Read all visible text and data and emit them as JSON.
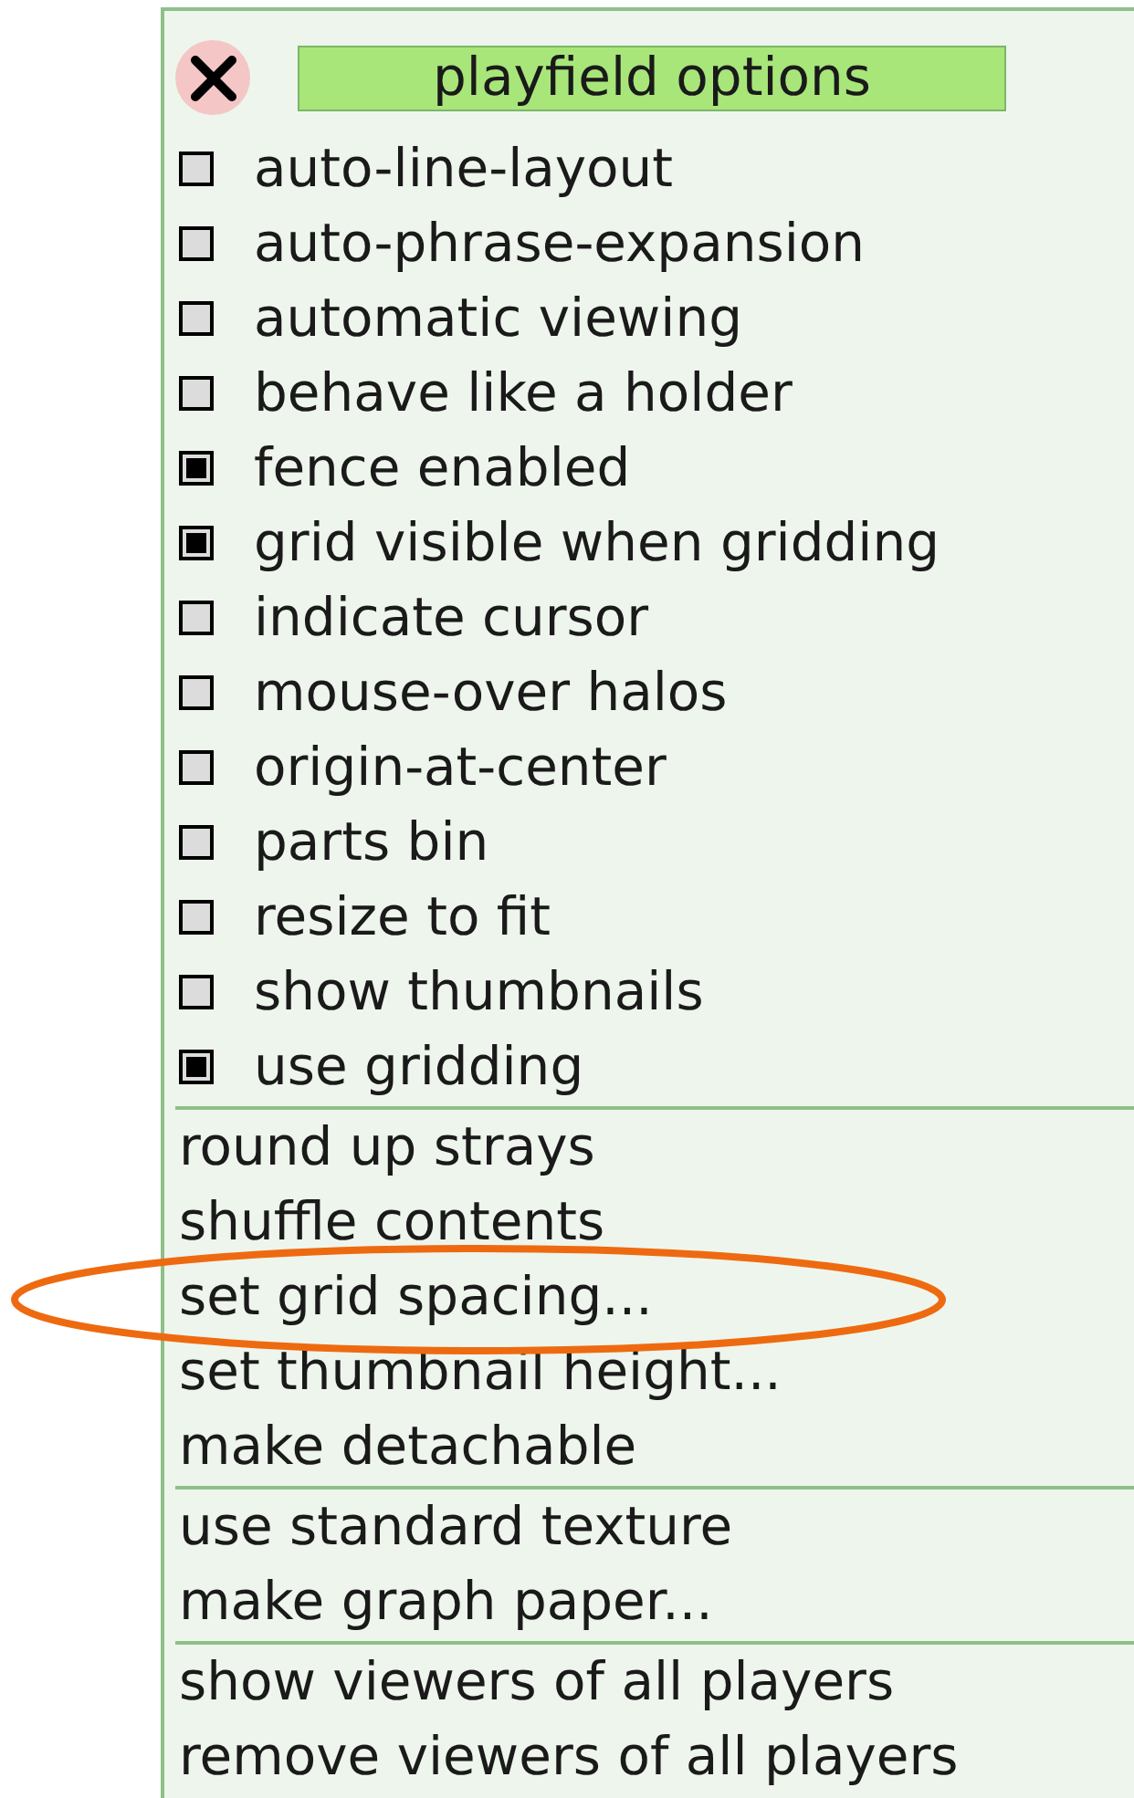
{
  "menu": {
    "title": "playfield options",
    "options": [
      {
        "label": "auto-line-layout",
        "checked": false
      },
      {
        "label": "auto-phrase-expansion",
        "checked": false
      },
      {
        "label": "automatic viewing",
        "checked": false
      },
      {
        "label": "behave like a holder",
        "checked": false
      },
      {
        "label": "fence enabled",
        "checked": true
      },
      {
        "label": "grid visible when gridding",
        "checked": true
      },
      {
        "label": "indicate cursor",
        "checked": false
      },
      {
        "label": "mouse-over halos",
        "checked": false
      },
      {
        "label": "origin-at-center",
        "checked": false
      },
      {
        "label": "parts bin",
        "checked": false
      },
      {
        "label": "resize to fit",
        "checked": false
      },
      {
        "label": "show thumbnails",
        "checked": false
      },
      {
        "label": "use gridding",
        "checked": true
      }
    ],
    "command_groups": [
      {
        "items": [
          {
            "label": "round up strays",
            "highlighted": false
          },
          {
            "label": "shuffle contents",
            "highlighted": false
          },
          {
            "label": "set grid spacing...",
            "highlighted": true
          },
          {
            "label": "set thumbnail height...",
            "highlighted": false
          },
          {
            "label": "make detachable",
            "highlighted": false
          }
        ]
      },
      {
        "items": [
          {
            "label": "use standard texture",
            "highlighted": false
          },
          {
            "label": "make graph paper...",
            "highlighted": false
          }
        ]
      },
      {
        "items": [
          {
            "label": "show viewers of all players",
            "highlighted": false
          },
          {
            "label": "remove viewers of all players",
            "highlighted": false
          }
        ]
      }
    ]
  }
}
